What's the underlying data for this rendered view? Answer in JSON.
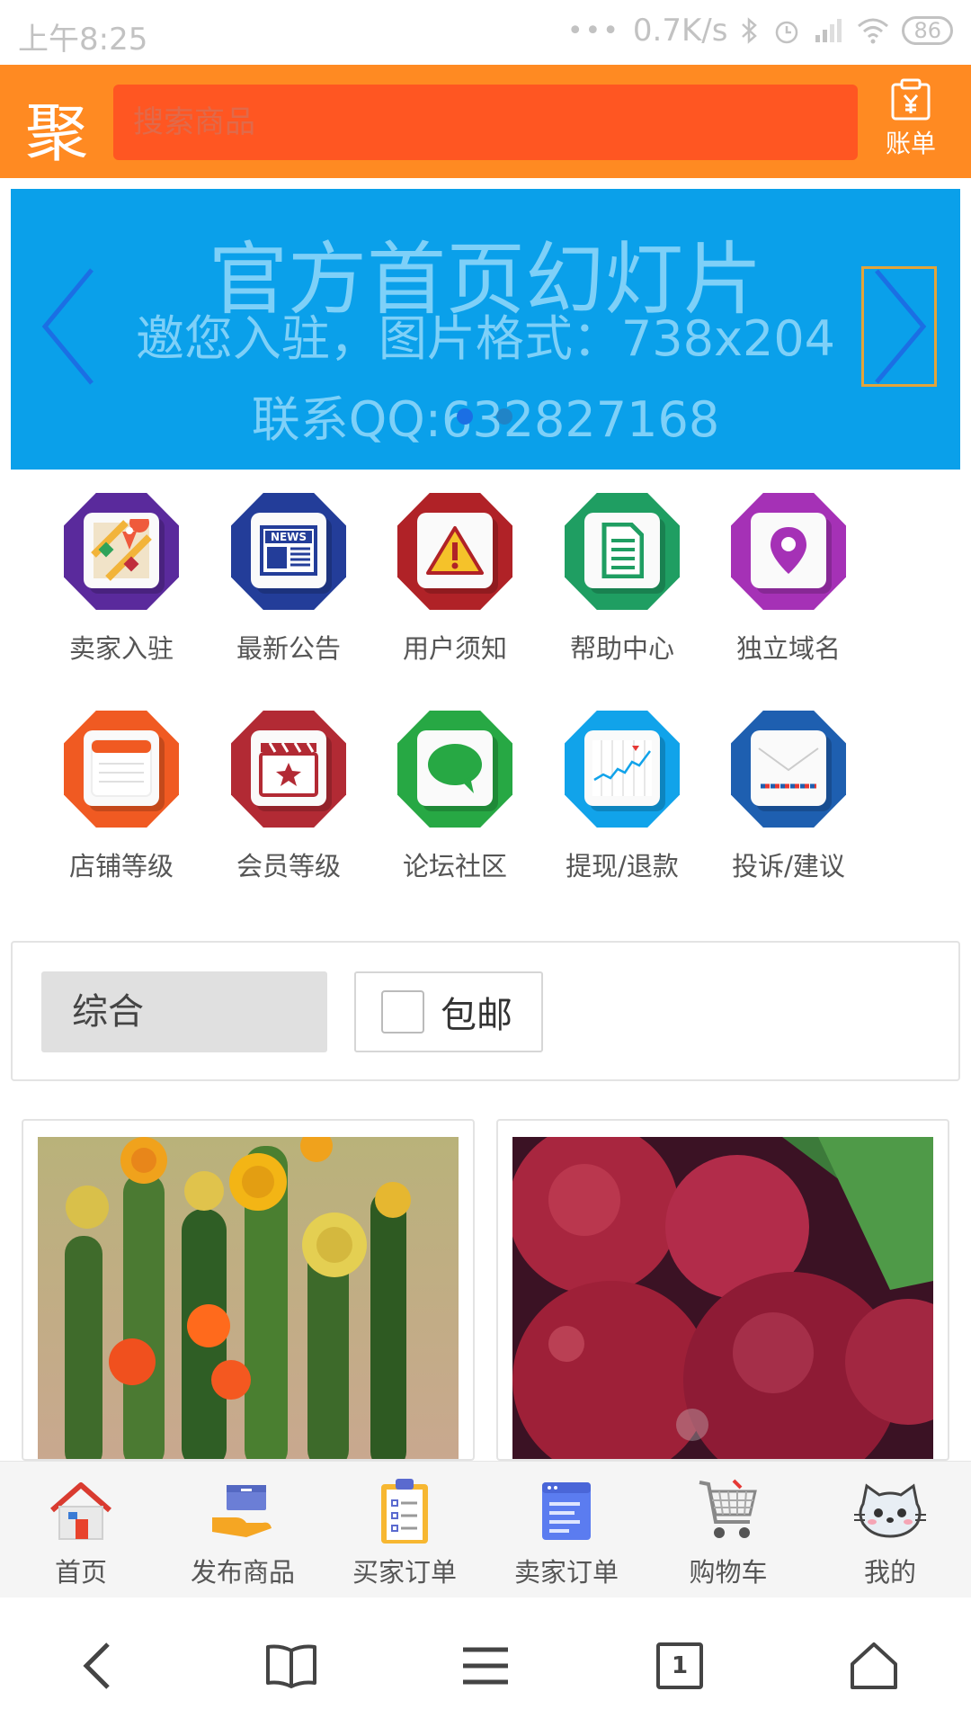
{
  "status_bar": {
    "time": "上午8:25",
    "dots": "•••",
    "network_speed": "0.7K/s",
    "icons": [
      "bluetooth-icon",
      "alarm-icon",
      "signal-icon",
      "wifi-icon"
    ],
    "battery": "86"
  },
  "header": {
    "logo": "聚",
    "search_placeholder": "搜索商品",
    "bill_label": "账单",
    "colors": {
      "bar": "#ff8a22",
      "search": "#ff5622"
    }
  },
  "banner": {
    "title": "官方首页幻灯片",
    "line2": "邀您入驻，图片格式：738x204",
    "line3": "联系QQ:632827168",
    "color": "#0aa0ea"
  },
  "menu": {
    "items": [
      {
        "label": "卖家入驻",
        "icon": "map-pin-icon",
        "color": "#5a2a9c"
      },
      {
        "label": "最新公告",
        "icon": "news-icon",
        "color": "#233d99"
      },
      {
        "label": "用户须知",
        "icon": "warning-icon",
        "color": "#b02227"
      },
      {
        "label": "帮助中心",
        "icon": "document-icon",
        "color": "#1f9e62"
      },
      {
        "label": "独立域名",
        "icon": "location-icon",
        "color": "#a531b6"
      },
      {
        "label": "店铺等级",
        "icon": "notepad-icon",
        "color": "#f05a22"
      },
      {
        "label": "会员等级",
        "icon": "star-clapper-icon",
        "color": "#b22a34"
      },
      {
        "label": "论坛社区",
        "icon": "chat-bubble-icon",
        "color": "#27a844"
      },
      {
        "label": "提现/退款",
        "icon": "chart-icon",
        "color": "#11a3ea"
      },
      {
        "label": "投诉/建议",
        "icon": "mail-icon",
        "color": "#1e5fb0"
      }
    ]
  },
  "filter": {
    "sort_label": "综合",
    "free_shipping_label": "包邮"
  },
  "products": [
    {
      "image": "cactus-flowers-image"
    },
    {
      "image": "plums-image"
    }
  ],
  "bottom_nav": {
    "items": [
      {
        "label": "首页",
        "icon": "home-icon"
      },
      {
        "label": "发布商品",
        "icon": "box-hand-icon"
      },
      {
        "label": "买家订单",
        "icon": "clipboard-icon"
      },
      {
        "label": "卖家订单",
        "icon": "list-doc-icon"
      },
      {
        "label": "购物车",
        "icon": "cart-icon"
      },
      {
        "label": "我的",
        "icon": "cat-face-icon"
      }
    ]
  },
  "system_nav": {
    "tab_count": "1",
    "icons": [
      "back-icon",
      "bookmarks-icon",
      "menu-icon",
      "tabs-icon",
      "home-outline-icon"
    ]
  }
}
